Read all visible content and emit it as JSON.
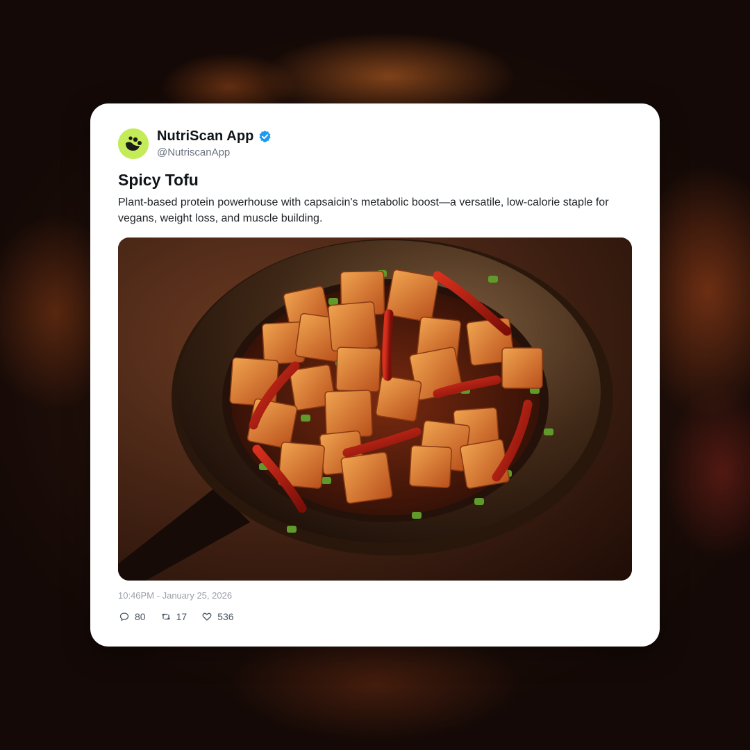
{
  "post": {
    "author_name": "NutriScan App",
    "author_handle": "@NutriscanApp",
    "verified": true,
    "title": "Spicy Tofu",
    "description": "Plant-based protein powerhouse with capsaicin's metabolic boost—a versatile, low-calorie staple for vegans, weight loss, and muscle building.",
    "image_subject": "spicy tofu cubes with red chilies and green onions in a wok",
    "timestamp": "10:46PM - January 25, 2026",
    "stats": {
      "replies": "80",
      "reposts": "17",
      "likes": "536"
    }
  },
  "icons": {
    "avatar": "nutriscan-logo-icon",
    "verified": "verified-badge-icon",
    "reply": "comment-icon",
    "repost": "repost-icon",
    "like": "heart-icon"
  },
  "colors": {
    "avatar_bg": "#c4ec58",
    "verified_blue": "#1d9bf0",
    "card_bg": "#ffffff",
    "text_primary": "#0f1419",
    "text_secondary": "#6b7280"
  }
}
